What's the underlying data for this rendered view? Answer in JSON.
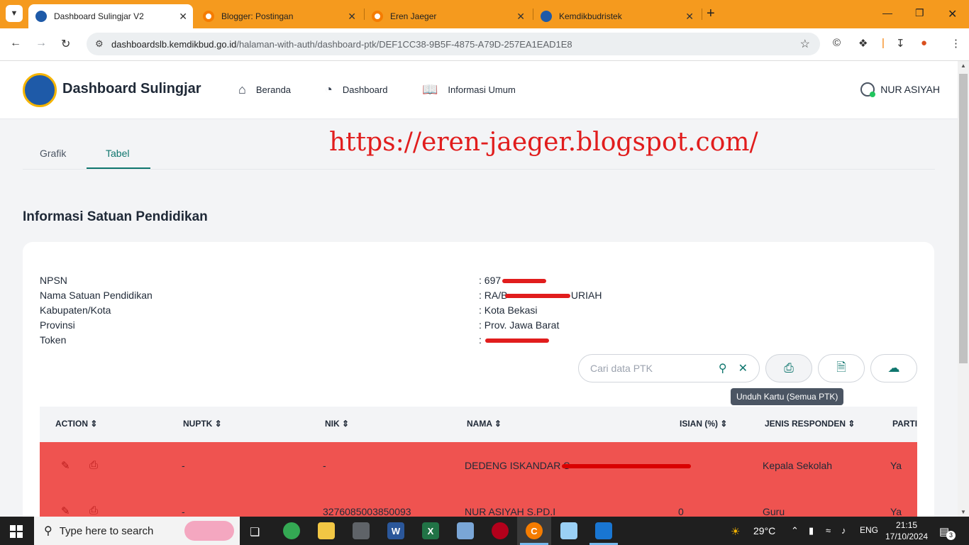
{
  "browser": {
    "tabs": [
      {
        "title": "Dashboard Sulingjar V2",
        "color": "#1e5aa8",
        "active": true
      },
      {
        "title": "Blogger: Postingan",
        "color": "#f57c00",
        "active": false
      },
      {
        "title": "Eren Jaeger",
        "color": "#f57c00",
        "active": false
      },
      {
        "title": "Kemdikbudristek",
        "color": "#1e5aa8",
        "active": false
      }
    ],
    "url_host": "dashboardslb.kemdikbud.go.id",
    "url_path": "/halaman-with-auth/dashboard-ptk/DEF1CC38-9B5F-4875-A79D-257EA1EAD1E8"
  },
  "header": {
    "brand": "Dashboard Sulingjar",
    "nav": [
      {
        "label": "Beranda",
        "icon": "home-icon"
      },
      {
        "label": "Dashboard",
        "icon": "pie-chart-icon"
      },
      {
        "label": "Informasi Umum",
        "icon": "book-icon"
      }
    ],
    "user_name": "NUR ASIYAH"
  },
  "subtabs": [
    "Grafik",
    "Tabel"
  ],
  "watermark": "https://eren-jaeger.blogspot.com/",
  "section_title": "Informasi Satuan Pendidikan",
  "info": [
    {
      "label": "NPSN",
      "value": ": 697"
    },
    {
      "label": "Nama Satuan Pendidikan",
      "value": ": RA/B                       URIAH"
    },
    {
      "label": "Kabupaten/Kota",
      "value": ": Kota Bekasi"
    },
    {
      "label": "Provinsi",
      "value": ": Prov. Jawa Barat"
    },
    {
      "label": "Token",
      "value": ":"
    }
  ],
  "search": {
    "placeholder": "Cari data PTK"
  },
  "tooltip": "Unduh Kartu (Semua PTK)",
  "table": {
    "columns": [
      "ACTION",
      "NUPTK",
      "NIK",
      "NAMA",
      "ISIAN (%)",
      "JENIS RESPONDEN",
      "PARTI"
    ],
    "rows": [
      {
        "nuptk": "-",
        "nik": "-",
        "nama": "DEDENG ISKANDAR S",
        "isian": "",
        "jenis": "Kepala Sekolah",
        "parti": "Ya"
      },
      {
        "nuptk": "-",
        "nik": "3276085003850093",
        "nama": "NUR ASIYAH S.PD.I",
        "isian": "0",
        "jenis": "Guru",
        "parti": "Ya"
      }
    ]
  },
  "taskbar": {
    "search_placeholder": "Type here to search",
    "weather": "29°C",
    "lang": "ENG",
    "time": "21:15",
    "date": "17/10/2024",
    "notif_count": "3"
  }
}
